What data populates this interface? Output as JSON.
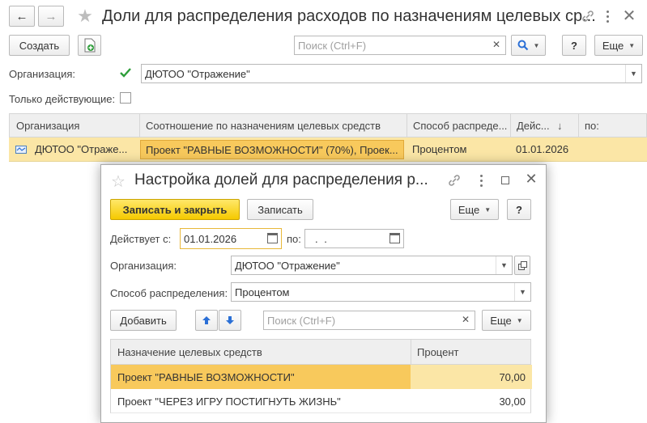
{
  "window": {
    "title": "Доли для распределения расходов по назначениям целевых ср...",
    "nav_back": "←",
    "nav_forward": "→"
  },
  "toolbar": {
    "create_label": "Создать",
    "search_placeholder": "Поиск (Ctrl+F)",
    "help_label": "?",
    "more_label": "Еще"
  },
  "filters": {
    "org_label": "Организация:",
    "org_value": "ДЮТОО \"Отражение\"",
    "only_active_label": "Только действующие:"
  },
  "list": {
    "columns": [
      "Организация",
      "Соотношение по назначениям целевых средств",
      "Способ распреде...",
      "Дейс...",
      "по:"
    ],
    "rows": [
      [
        "ДЮТОО \"Отраже...",
        "Проект \"РАВНЫЕ ВОЗМОЖНОСТИ\" (70%), Проек...",
        "Процентом",
        "01.01.2026",
        ""
      ]
    ]
  },
  "dialog": {
    "title": "Настройка долей для распределения р...",
    "save_close_label": "Записать и закрыть",
    "save_label": "Записать",
    "more_label": "Еще",
    "help_label": "?",
    "valid_from_label": "Действует с:",
    "valid_from_value": "01.01.2026",
    "to_label": "по:",
    "to_value": ".  .",
    "org_label": "Организация:",
    "org_value": "ДЮТОО \"Отражение\"",
    "method_label": "Способ распределения:",
    "method_value": "Процентом",
    "add_label": "Добавить",
    "search_placeholder": "Поиск (Ctrl+F)",
    "more2_label": "Еще",
    "table": {
      "columns": [
        "Назначение целевых средств",
        "Процент"
      ],
      "rows": [
        [
          "Проект \"РАВНЫЕ ВОЗМОЖНОСТИ\"",
          "70,00"
        ],
        [
          "Проект \"ЧЕРЕЗ ИГРУ ПОСТИГНУТЬ ЖИЗНЬ\"",
          "30,00"
        ]
      ]
    }
  },
  "colors": {
    "accent_yellow": "#f5c900",
    "selected_row": "#fbe6a6",
    "selected_cell": "#f8c95c",
    "check_green": "#2e9e3a",
    "blue_icon": "#2a6fd6"
  }
}
